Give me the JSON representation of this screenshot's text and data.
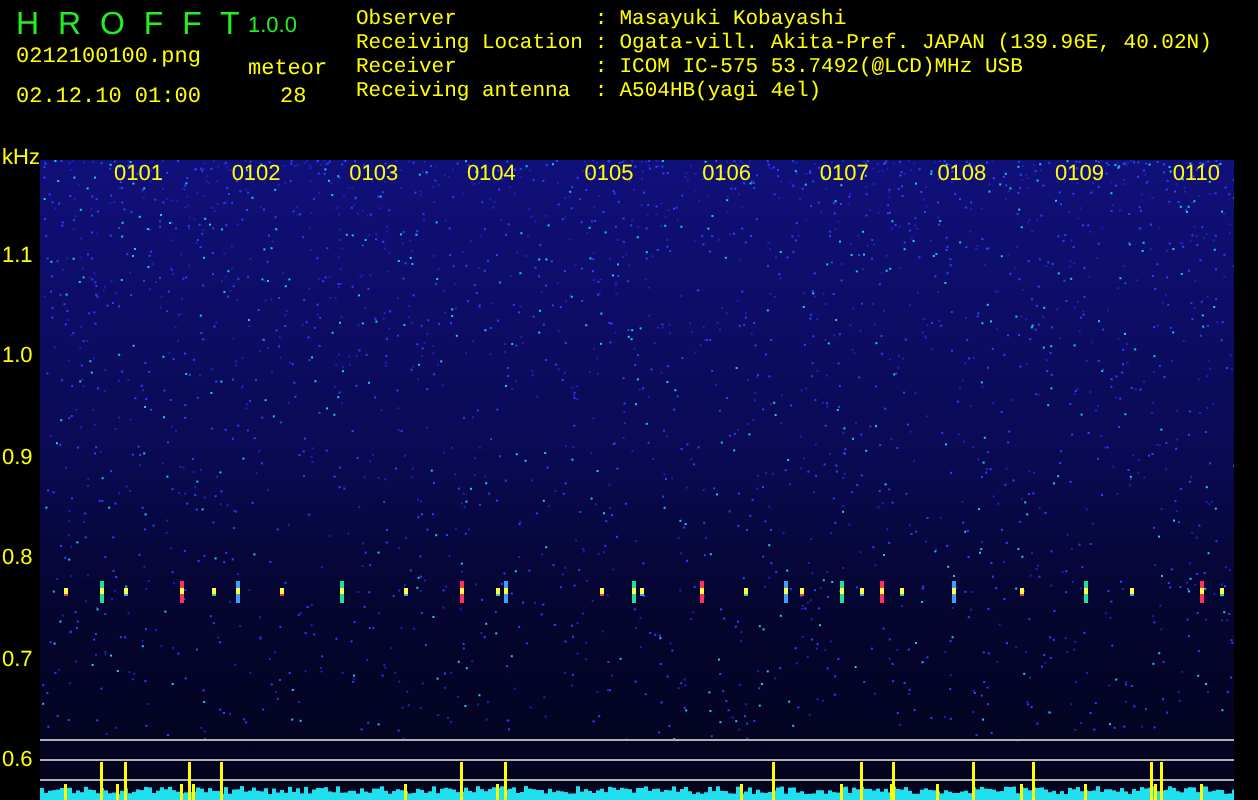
{
  "app": {
    "title": "H R O F F T",
    "version": "1.0.0"
  },
  "file": {
    "name": "0212100100.png",
    "datetime": "02.12.10 01:00"
  },
  "meteor": {
    "label": "meteor",
    "count": "28"
  },
  "info": [
    {
      "label": "Observer",
      "separator": ":",
      "value": "Masayuki Kobayashi"
    },
    {
      "label": "Receiving Location",
      "separator": ":",
      "value": "Ogata-vill. Akita-Pref. JAPAN (139.96E, 40.02N)"
    },
    {
      "label": "Receiver",
      "separator": ":",
      "value": "ICOM IC-575 53.7492(@LCD)MHz USB"
    },
    {
      "label": "Receiving antenna",
      "separator": ":",
      "value": "A504HB(yagi 4el)"
    }
  ],
  "axis": {
    "unit": "kHz",
    "y_labels": [
      "1.1",
      "1.0",
      "0.9",
      "0.8",
      "0.7",
      "0.6"
    ],
    "time_labels": [
      "0101",
      "0102",
      "0103",
      "0104",
      "0105",
      "0106",
      "0107",
      "0108",
      "0109",
      "0110"
    ]
  }
}
